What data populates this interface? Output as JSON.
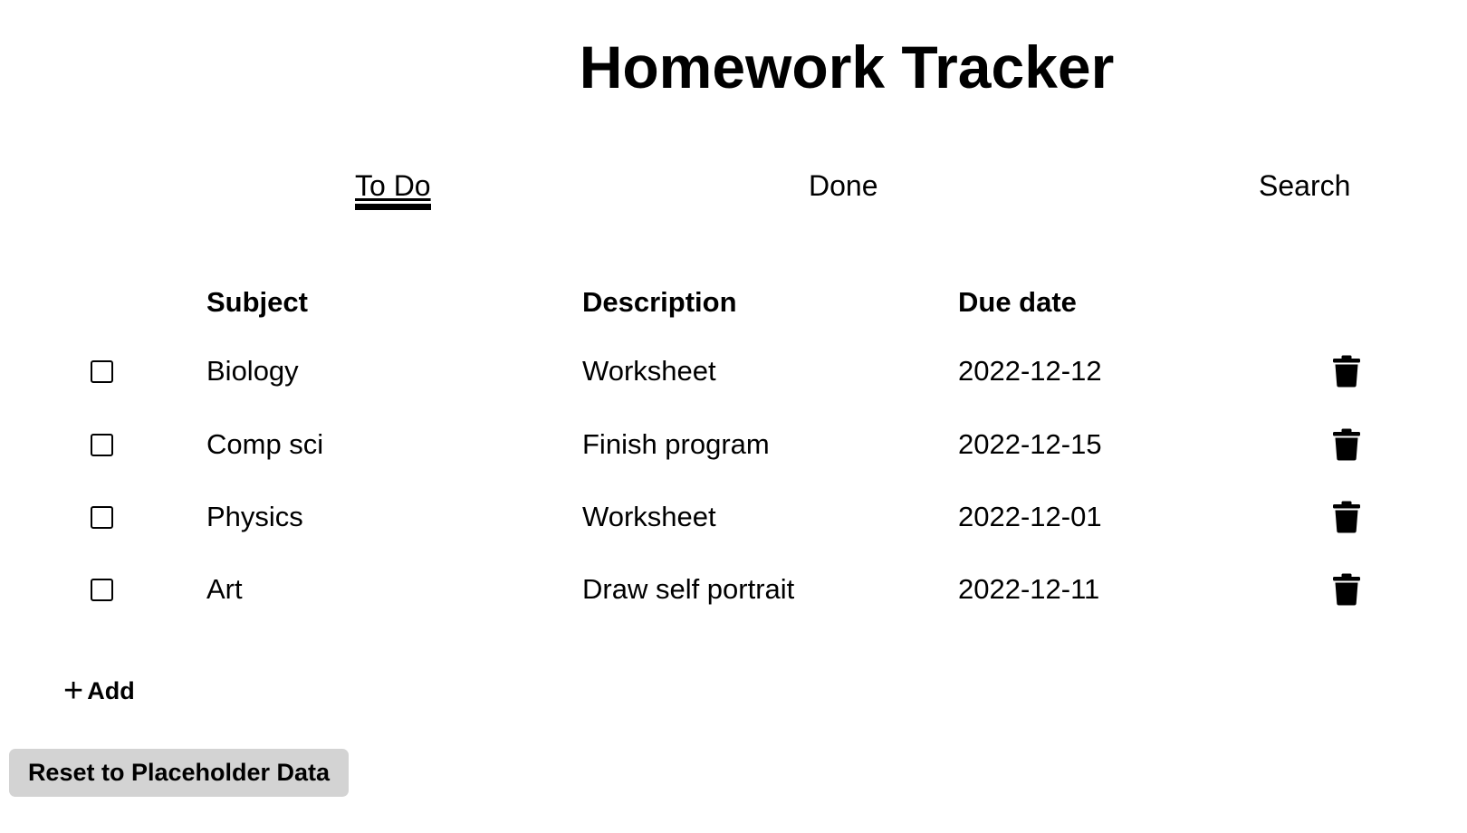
{
  "app": {
    "title": "Homework Tracker"
  },
  "tabs": [
    {
      "label": "To Do",
      "active": true
    },
    {
      "label": "Done",
      "active": false
    },
    {
      "label": "Search",
      "active": false
    }
  ],
  "table": {
    "headers": {
      "subject": "Subject",
      "description": "Description",
      "due_date": "Due date"
    },
    "rows": [
      {
        "subject": "Biology",
        "description": "Worksheet",
        "due_date": "2022-12-12",
        "checked": false
      },
      {
        "subject": "Comp sci",
        "description": "Finish program",
        "due_date": "2022-12-15",
        "checked": false
      },
      {
        "subject": "Physics",
        "description": "Worksheet",
        "due_date": "2022-12-01",
        "checked": false
      },
      {
        "subject": "Art",
        "description": "Draw self portrait",
        "due_date": "2022-12-11",
        "checked": false
      }
    ]
  },
  "actions": {
    "add_icon": "plus-icon",
    "add_label": "Add",
    "reset_label": "Reset to Placeholder Data",
    "delete_icon": "trash-icon"
  },
  "colors": {
    "text": "#000000",
    "background": "#ffffff",
    "reset_button_bg": "#d3d3d3"
  }
}
